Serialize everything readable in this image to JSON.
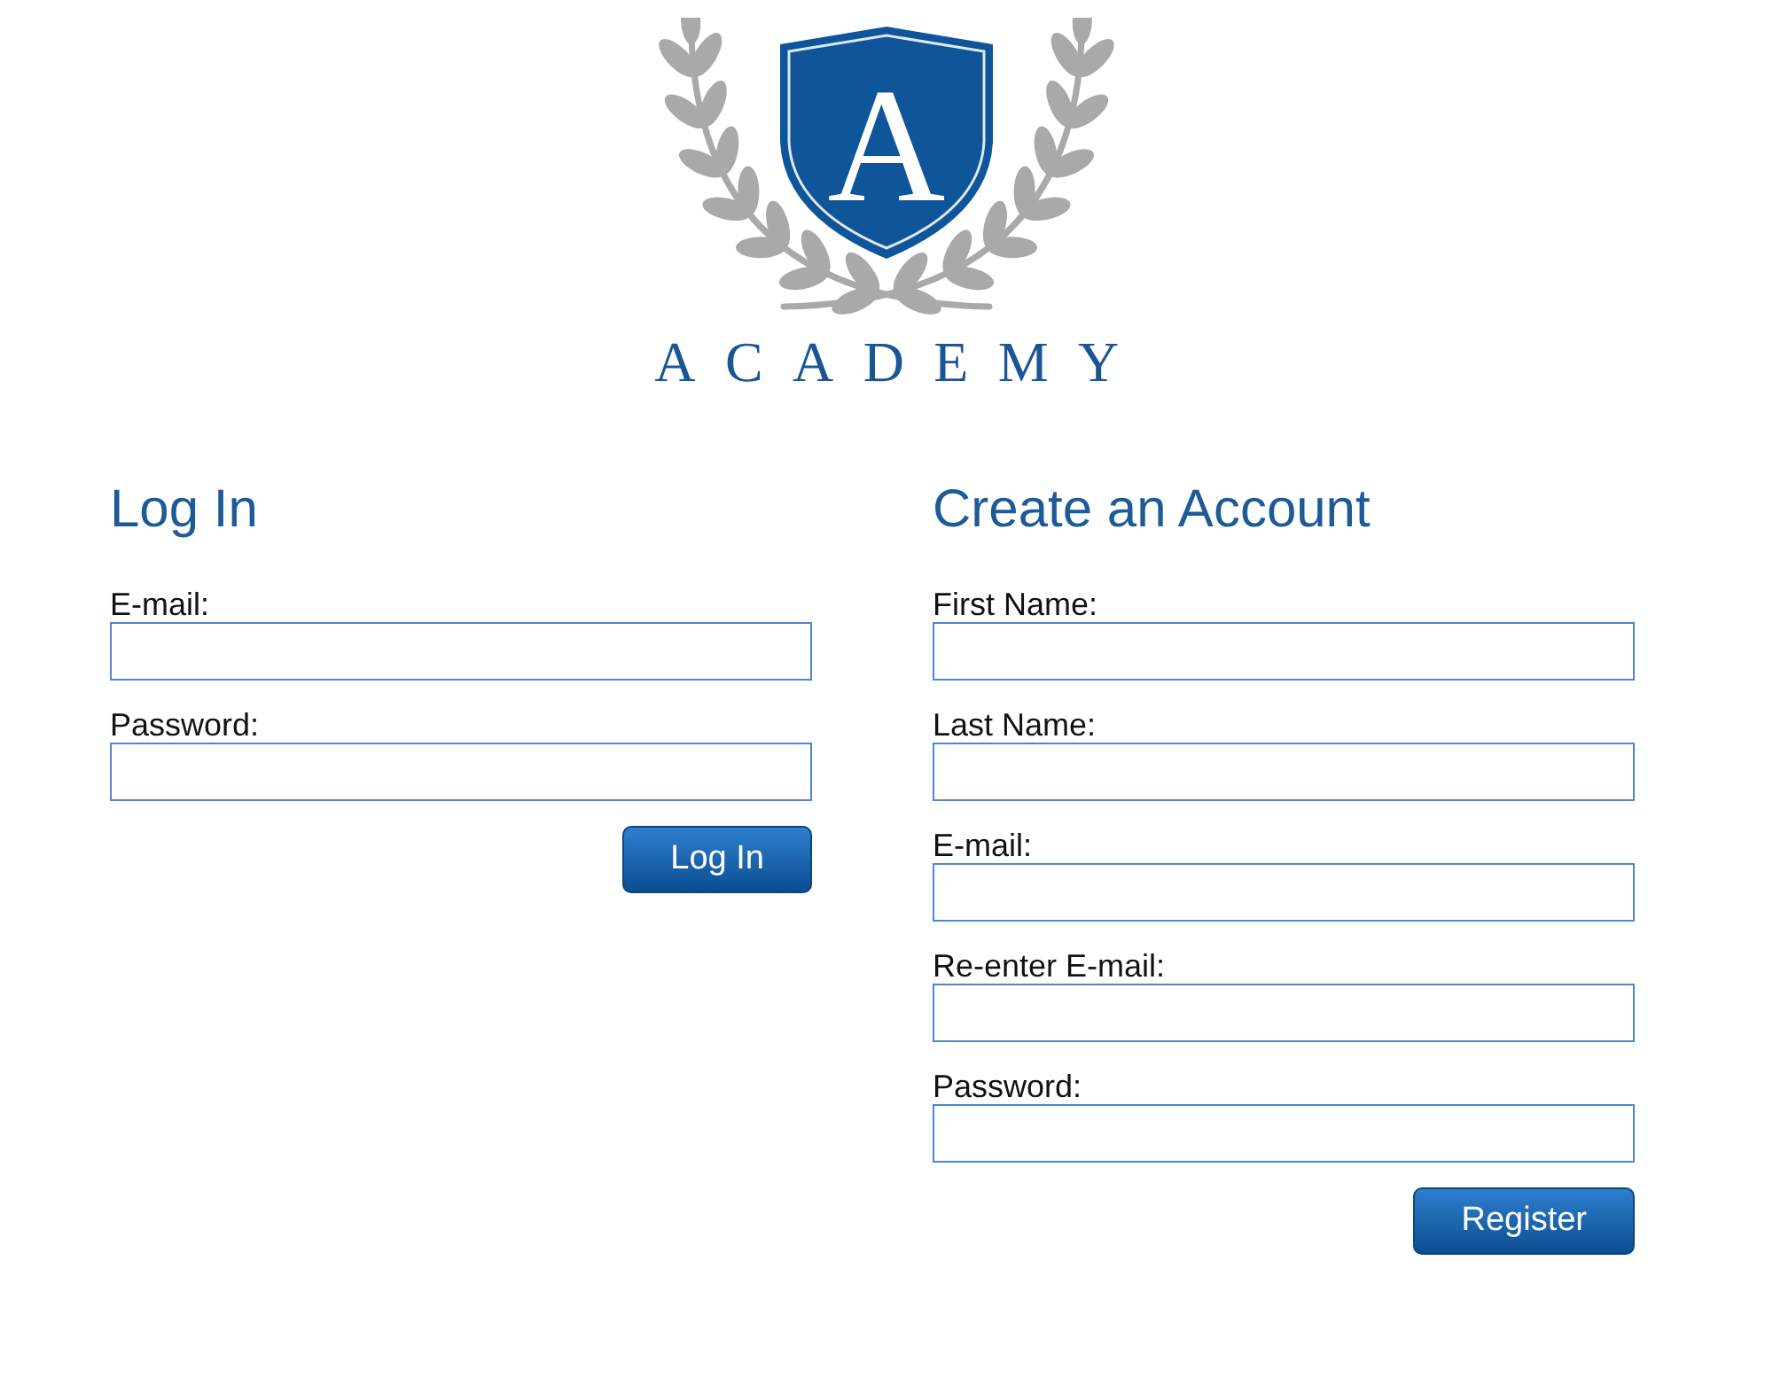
{
  "logo": {
    "monogram": "A",
    "wordmark": "ACADEMY"
  },
  "login": {
    "title": "Log In",
    "fields": [
      {
        "label": "E-mail:"
      },
      {
        "label": "Password:"
      }
    ],
    "button": "Log In"
  },
  "register": {
    "title": "Create an Account",
    "fields": [
      {
        "label": "First Name:"
      },
      {
        "label": "Last Name:"
      },
      {
        "label": "E-mail:"
      },
      {
        "label": "Re-enter E-mail:"
      },
      {
        "label": "Password:"
      }
    ],
    "button": "Register"
  }
}
